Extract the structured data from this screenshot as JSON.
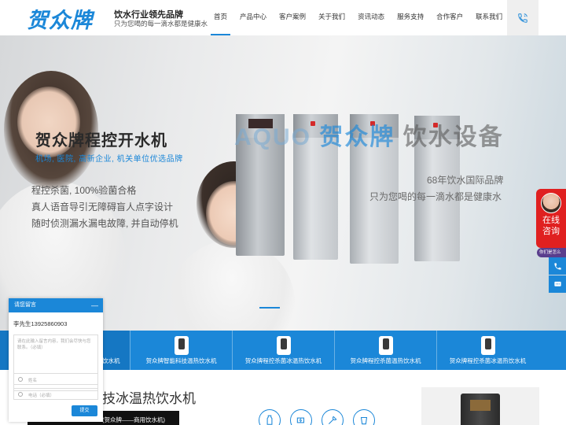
{
  "header": {
    "logo_text": "贺众牌",
    "slogan_title": "饮水行业领先品牌",
    "slogan_sub": "只为您喝的每一滴水都是健康水",
    "nav": [
      "首页",
      "产品中心",
      "客户案例",
      "关于我们",
      "资讯动态",
      "服务支持",
      "合作客户",
      "联系我们"
    ],
    "active_nav": "首页",
    "phone_icon": "phone-icon"
  },
  "hero": {
    "title": "贺众牌程控开水机",
    "subtitle": "机场, 医院, 高新企业, 机关单位优选品牌",
    "features": [
      "程控杀菌, 100%验菌合格",
      "真人语音导引无障碍盲人点字设计",
      "随时侦测漏水漏电故障, 并自动停机"
    ],
    "brand_en": "AQUO",
    "brand_logo": "贺众牌",
    "brand_cn": "饮水设备",
    "brand_note_1": "68年饮水国际品牌",
    "brand_note_2": "只为您喝的每一滴水都是健康水"
  },
  "products": [
    {
      "label": "饮水机"
    },
    {
      "label": "贺众牌智能科技温热饮水机"
    },
    {
      "label": "贺众牌程控杀菌冰温热饮水机"
    },
    {
      "label": "贺众牌程控杀菌温热饮水机"
    },
    {
      "label": "贺众牌程控杀菌冰温热饮水机"
    }
  ],
  "section": {
    "title": "技冰温热饮水机",
    "tag": "(贺众牌——商用饮水机)"
  },
  "chat": {
    "header": "请您留言",
    "minimize": "—",
    "contact": "李先生13925860903",
    "message_placeholder": "请在此输入留言内容，我们会尽快与您联系。（必填）",
    "name_placeholder": "姓名",
    "phone_placeholder": "电话（必填）",
    "submit": "提交"
  },
  "float": {
    "online_text_1": "在线",
    "online_text_2": "咨询",
    "mini": "你们是怎么"
  },
  "colors": {
    "brand_blue": "#1b87d8",
    "float_red": "#e02020"
  }
}
